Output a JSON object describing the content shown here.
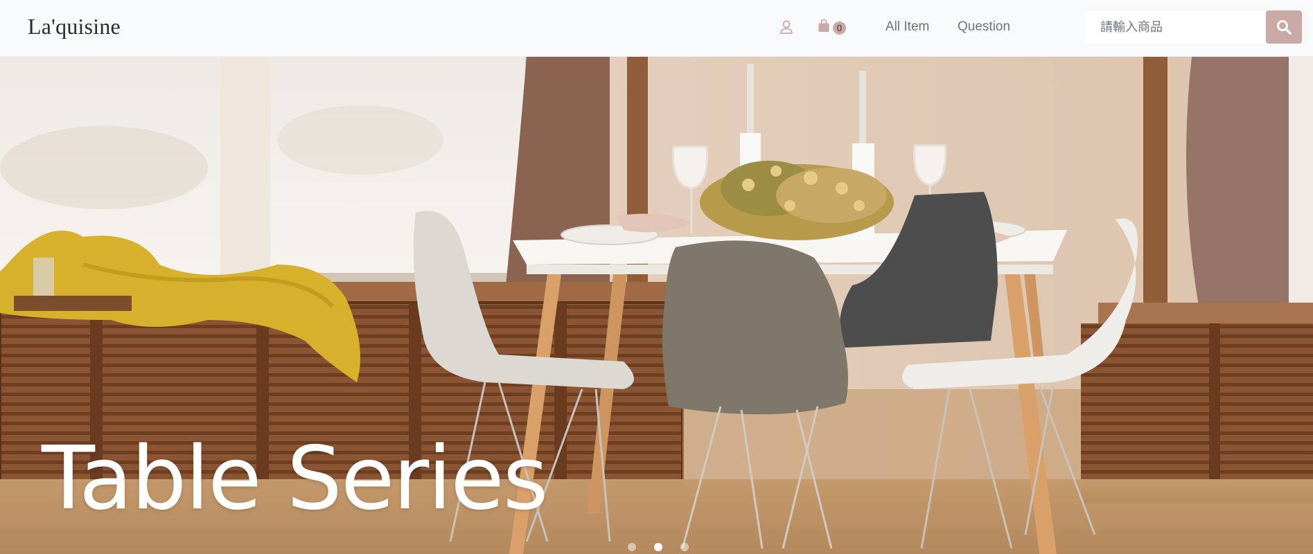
{
  "navbar": {
    "brand": "La'quisine",
    "user_icon": "user-icon",
    "cart_icon": "shopping-bag-icon",
    "cart_count": "0",
    "links": {
      "all_item": "All Item",
      "question": "Question"
    },
    "search": {
      "placeholder": "請輸入商品",
      "value": "",
      "button_icon": "search-icon"
    }
  },
  "hero": {
    "title": "Table Series",
    "slides": {
      "count": 3,
      "active_index": 1
    }
  },
  "colors": {
    "navbar_bg": "#f8f9fa",
    "accent": "#c9aaa6",
    "nav_text": "#6c757d",
    "brand_text": "#2b2b2b"
  }
}
